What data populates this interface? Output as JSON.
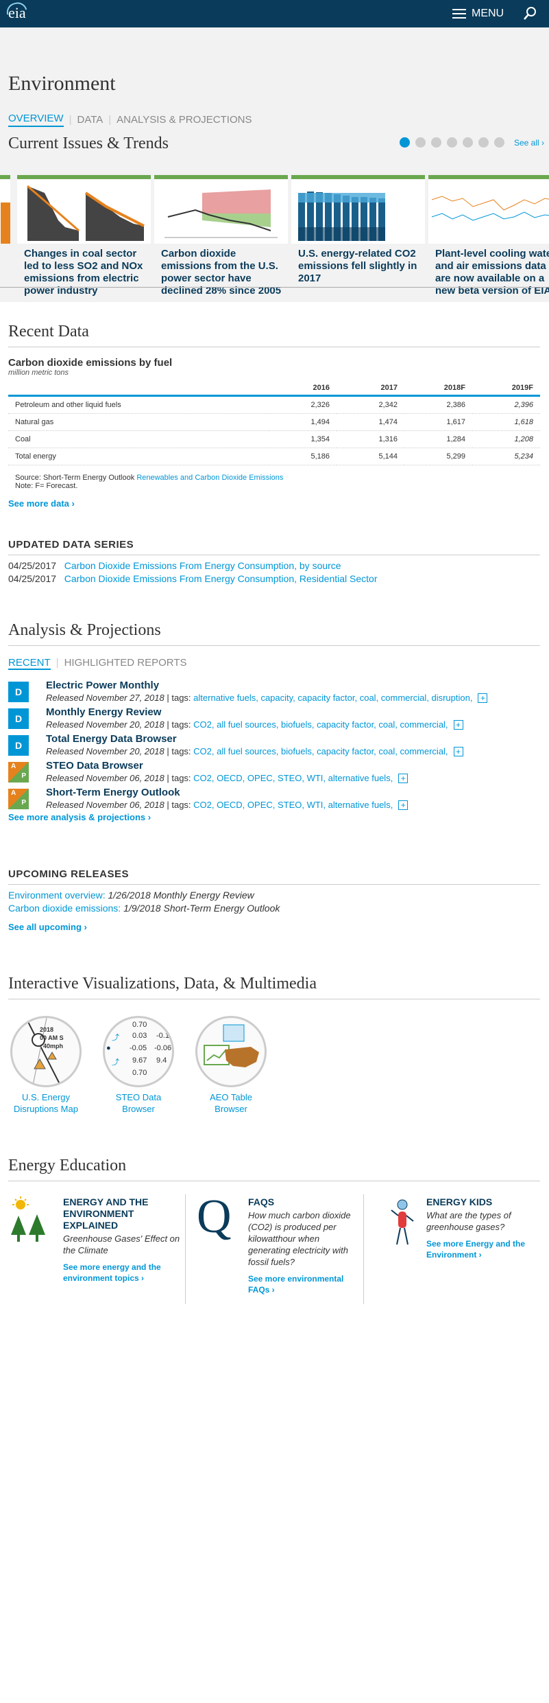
{
  "header": {
    "logo": "eia",
    "menu_label": "MENU"
  },
  "page": {
    "title": "Environment"
  },
  "subnav": {
    "overview": "OVERVIEW",
    "data": "DATA",
    "analysis": "ANALYSIS & PROJECTIONS"
  },
  "trends": {
    "title": "Current Issues & Trends",
    "see_all": "See all ›",
    "cards": [
      {
        "text": "Changes in coal sector led to less SO2 and NOx emissions from electric power industry"
      },
      {
        "text": "Carbon dioxide emissions from the U.S. power sector have declined 28% since 2005"
      },
      {
        "text": "U.S. energy-related CO2 emissions fell slightly in 2017"
      },
      {
        "text": "Plant-level cooling water and air emissions data are now available on a new beta version of EIA's Electricity Data Browser"
      }
    ]
  },
  "recent_data": {
    "title": "Recent Data",
    "table_title": "Carbon dioxide emissions by fuel",
    "units": "million metric tons",
    "columns": [
      "2016",
      "2017",
      "2018F",
      "2019F"
    ],
    "rows": [
      {
        "label": "Petroleum and other liquid fuels",
        "v": [
          "2,326",
          "2,342",
          "2,386",
          "2,396"
        ]
      },
      {
        "label": "Natural gas",
        "v": [
          "1,494",
          "1,474",
          "1,617",
          "1,618"
        ]
      },
      {
        "label": "Coal",
        "v": [
          "1,354",
          "1,316",
          "1,284",
          "1,208"
        ]
      },
      {
        "label": "Total energy",
        "v": [
          "5,186",
          "5,144",
          "5,299",
          "5,234"
        ]
      }
    ],
    "source_prefix": "Source: Short-Term Energy Outlook",
    "source_link": "Renewables and Carbon Dioxide Emissions",
    "note": "Note: F= Forecast.",
    "see_more": "See more data ›"
  },
  "updated_series": {
    "title": "UPDATED DATA SERIES",
    "items": [
      {
        "date": "04/25/2017",
        "label": "Carbon Dioxide Emissions From Energy Consumption, by source"
      },
      {
        "date": "04/25/2017",
        "label": "Carbon Dioxide Emissions From Energy Consumption, Residential Sector"
      }
    ]
  },
  "analysis": {
    "title": "Analysis & Projections",
    "tab_recent": "RECENT",
    "tab_highlighted": "HIGHLIGHTED REPORTS",
    "reports": [
      {
        "badge": "D",
        "title": "Electric Power Monthly",
        "released": "Released November 27, 2018",
        "tags_label": "| tags:",
        "tags": "alternative fuels, capacity, capacity factor, coal, commercial, disruption,"
      },
      {
        "badge": "D",
        "title": "Monthly Energy Review",
        "released": "Released November 20, 2018",
        "tags_label": "| tags:",
        "tags": "CO2, all fuel sources, biofuels, capacity factor, coal, commercial,"
      },
      {
        "badge": "D",
        "title": "Total Energy Data Browser",
        "released": "Released November 20, 2018",
        "tags_label": "| tags:",
        "tags": "CO2, all fuel sources, biofuels, capacity factor, coal, commercial,"
      },
      {
        "badge": "A P",
        "title": "STEO Data Browser",
        "released": "Released November 06, 2018",
        "tags_label": "| tags:",
        "tags": "CO2, OECD, OPEC, STEO, WTI, alternative fuels,"
      },
      {
        "badge": "A P",
        "title": "Short-Term Energy Outlook",
        "released": "Released November 06, 2018",
        "tags_label": "| tags:",
        "tags": "CO2, OECD, OPEC, STEO, WTI, alternative fuels,"
      }
    ],
    "plus": "+",
    "see_more": "See more analysis & projections ›"
  },
  "upcoming": {
    "title": "UPCOMING RELEASES",
    "items": [
      {
        "link": "Environment overview:",
        "text": "1/26/2018 Monthly Energy Review"
      },
      {
        "link": "Carbon dioxide emissions:",
        "text": "1/9/2018 Short-Term Energy Outlook"
      }
    ],
    "see_all": "See all upcoming ›"
  },
  "viz": {
    "title": "Interactive Visualizations, Data, & Multimedia",
    "items": [
      {
        "label": "U.S. Energy Disruptions Map"
      },
      {
        "label": "STEO Data Browser"
      },
      {
        "label": "AEO Table Browser"
      }
    ],
    "map_texts": [
      "2018",
      "00 AM S",
      "40mph"
    ],
    "steo_values": [
      "0.70",
      "0.03",
      "-0.1",
      "-0.05",
      "-0.06",
      "9.67",
      "9.4",
      "0.70"
    ]
  },
  "education": {
    "title": "Energy Education",
    "cols": [
      {
        "title": "ENERGY AND THE ENVIRONMENT EXPLAINED",
        "text": "Greenhouse Gases' Effect on the Climate",
        "more": "See more energy and the environment topics ›"
      },
      {
        "title": "FAQS",
        "text": "How much carbon dioxide (CO2) is produced per kilowatthour when generating electricity with fossil fuels?",
        "more": "See more environmental FAQs ›"
      },
      {
        "title": "ENERGY KIDS",
        "text": "What are the types of greenhouse gases?",
        "more": "See more Energy and the Environment ›"
      }
    ]
  },
  "colors": {
    "navy": "#0a3b5a",
    "accent": "#0096d6",
    "green": "#6aa84f",
    "orange": "#e6821e"
  }
}
